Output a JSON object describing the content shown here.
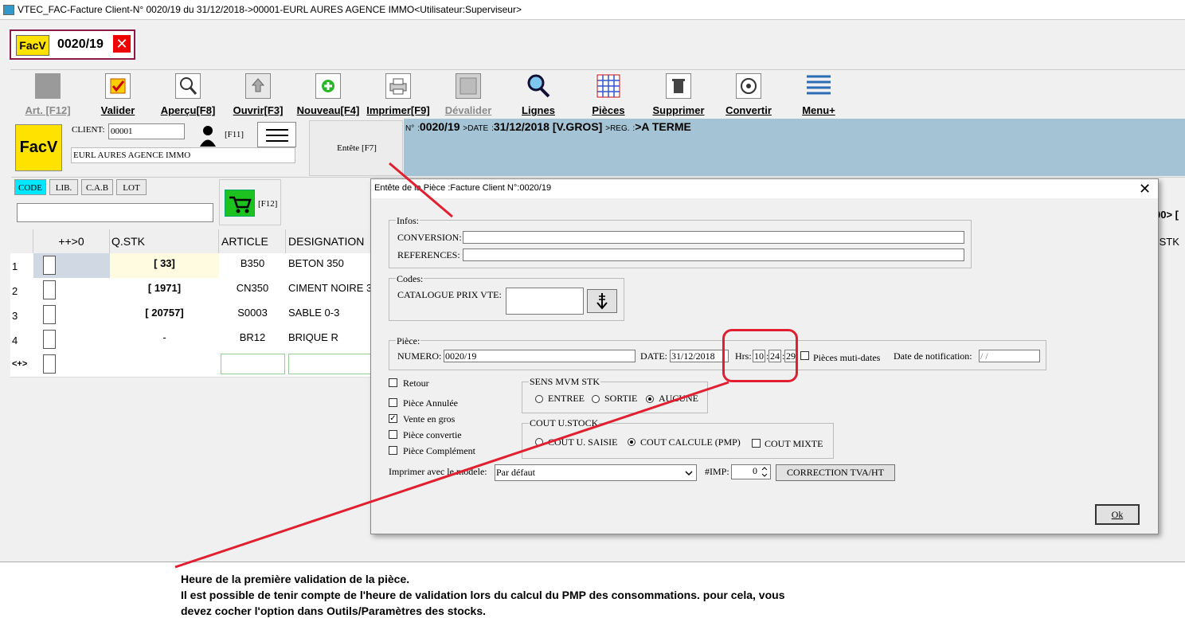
{
  "window": {
    "title": "VTEC_FAC-Facture Client-N° 0020/19 du 31/12/2018->00001-EURL AURES AGENCE IMMO<Utilisateur:Superviseur>"
  },
  "doc_tab": {
    "logo": "FacV",
    "number": "0020/19",
    "close": "✕"
  },
  "toolbar": [
    {
      "label": "Art. [F12]",
      "icon": "article-icon",
      "disabled": true
    },
    {
      "label": "Valider",
      "icon": "validate-check-icon",
      "disabled": false
    },
    {
      "label": "Aperçu[F8]",
      "icon": "preview-magnifier-icon",
      "disabled": false
    },
    {
      "label": "Ouvrir[F3]",
      "icon": "open-arrow-up-icon",
      "disabled": false
    },
    {
      "label": "Nouveau[F4]",
      "icon": "new-plus-icon",
      "disabled": false
    },
    {
      "label": "Imprimer[F9]",
      "icon": "printer-icon",
      "disabled": false
    },
    {
      "label": "Dévalider",
      "icon": "unvalidate-icon",
      "disabled": true
    },
    {
      "label": "Lignes",
      "icon": "lines-magnifier-icon",
      "disabled": false
    },
    {
      "label": "Pièces",
      "icon": "pieces-grid-icon",
      "disabled": false
    },
    {
      "label": "Supprimer",
      "icon": "trash-icon",
      "disabled": false
    },
    {
      "label": "Convertir",
      "icon": "convert-gear-icon",
      "disabled": false
    },
    {
      "label": "Menu+",
      "icon": "menu-lines-icon",
      "disabled": false
    }
  ],
  "header": {
    "logo": "FacV",
    "client_label": "CLIENT:",
    "client_code": "00001",
    "client_name": "EURL AURES AGENCE IMMO",
    "f11": "[F11]",
    "entete_button": "Entête [F7]",
    "info": {
      "n_label": "N°",
      "number": "0020/19",
      "date_label": "DATE",
      "date": "31/12/2018",
      "type": "[V.GROS]",
      "reg_label": "REG.",
      "reg": ">A TERME"
    }
  },
  "search": {
    "modes": [
      "CODE",
      "LIB.",
      "C.A.B",
      "LOT"
    ],
    "active_mode": "CODE",
    "input_value": "",
    "cart_key": "[F12]",
    "right_stub1": "00>  [",
    "right_stub2": ".STK"
  },
  "grid": {
    "headers": [
      "++>0",
      "Q.STK",
      "ARTICLE",
      "DESIGNATION"
    ],
    "rows": [
      {
        "num": "1",
        "qstk": "[ 33]",
        "article": "B350",
        "designation": "BETON 350"
      },
      {
        "num": "2",
        "qstk": "[ 1971]",
        "article": "CN350",
        "designation": "CIMENT NOIRE 3"
      },
      {
        "num": "3",
        "qstk": "[ 20757]",
        "article": "S0003",
        "designation": "SABLE 0-3"
      },
      {
        "num": "4",
        "qstk": "-",
        "article": "BR12",
        "designation": "BRIQUE R"
      }
    ],
    "new_row_marker": "<+>"
  },
  "dialog": {
    "title": "Entête de la Pièce :Facture Client N°:0020/19",
    "close": "✕",
    "infos": {
      "legend": "Infos:",
      "conversion_label": "CONVERSION:",
      "conversion_value": "",
      "references_label": "REFERENCES:",
      "references_value": ""
    },
    "codes": {
      "legend": "Codes:",
      "catalogue_label": "CATALOGUE PRIX VTE:",
      "catalogue_value": ""
    },
    "piece": {
      "legend": "Pièce:",
      "numero_label": "NUMERO:",
      "numero_value": "0020/19",
      "date_label": "DATE:",
      "date_value": "31/12/2018",
      "hrs_label": "Hrs:",
      "hh": "10",
      "mm": "24",
      "ss": "29",
      "multidates_label": "Pièces muti-dates",
      "notif_label": "Date de notification:",
      "notif_value": " / /"
    },
    "options": [
      {
        "label": "Retour",
        "checked": false
      },
      {
        "label": "Pièce Annulée",
        "checked": false
      },
      {
        "label": "Vente en gros",
        "checked": true
      },
      {
        "label": "Pièce convertie",
        "checked": false
      },
      {
        "label": "Pièce Complément",
        "checked": false
      }
    ],
    "check_mark": "✓",
    "sens": {
      "legend": "SENS MVM STK",
      "options": [
        "ENTREE",
        "SORTIE",
        "AUCUNE"
      ],
      "selected": "AUCUNE"
    },
    "cout": {
      "legend": "COUT U.STOCK",
      "options": [
        "COUT U. SAISIE",
        "COUT CALCULE (PMP)"
      ],
      "selected": "COUT CALCULE (PMP)",
      "mixte_label": "COUT MIXTE",
      "mixte_checked": false
    },
    "print_model_label": "Imprimer avec le modele:",
    "print_model_value": "Par défaut",
    "imp_label": "#IMP:",
    "imp_value": "0",
    "correction_button": "CORRECTION TVA/HT",
    "ok_button": "Ok"
  },
  "annotation": {
    "color": "#e02030",
    "lines": [
      "Heure de la première validation de la pièce.",
      "Il est possible de tenir compte de l'heure de validation lors du calcul du PMP des consommations. pour cela, vous",
      "devez cocher l'option dans Outils/Paramètres des stocks."
    ]
  }
}
